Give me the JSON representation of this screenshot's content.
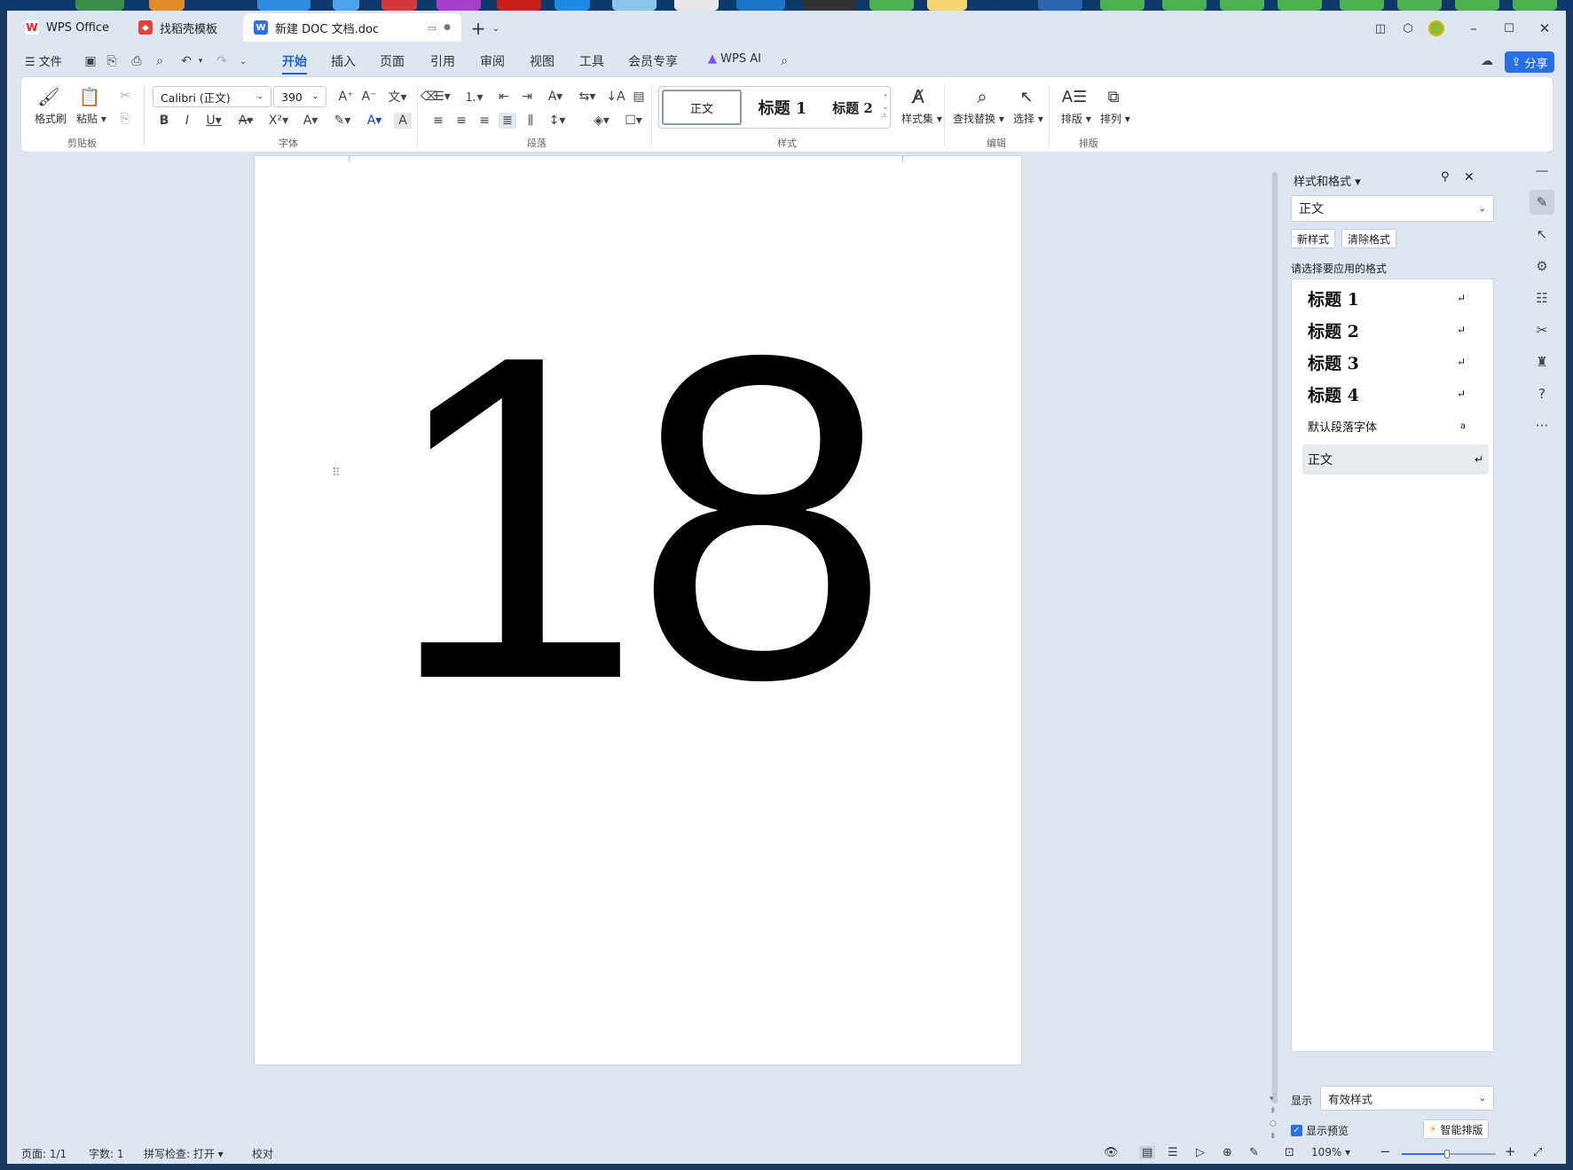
{
  "tabs": [
    {
      "label": "WPS Office",
      "icon": "wps-logo-icon"
    },
    {
      "label": "找稻壳模板",
      "icon": "docer-icon"
    },
    {
      "label": "新建 DOC 文档.doc",
      "icon": "word-doc-icon"
    }
  ],
  "menu": {
    "file": "文件",
    "tabs": [
      "开始",
      "插入",
      "页面",
      "引用",
      "审阅",
      "视图",
      "工具",
      "会员专享"
    ],
    "active": "开始",
    "wps_ai": "WPS AI",
    "share": "分享"
  },
  "ribbon": {
    "clipboard": {
      "format_painter": "格式刷",
      "paste": "粘贴",
      "group": "剪贴板"
    },
    "font": {
      "name": "Calibri (正文)",
      "size": "390",
      "group": "字体"
    },
    "paragraph": {
      "group": "段落"
    },
    "styles": {
      "items": [
        "正文",
        "标题 1",
        "标题 2"
      ],
      "style_set": "样式集",
      "group": "样式"
    },
    "edit": {
      "find_replace": "查找替换",
      "select": "选择",
      "group": "编辑"
    },
    "layout": {
      "typeset": "排版",
      "arrange": "排列",
      "group": "排版"
    }
  },
  "document": {
    "content": "18"
  },
  "panel": {
    "title": "样式和格式",
    "current_style": "正文",
    "new_style": "新样式",
    "clear_format": "清除格式",
    "prompt": "请选择要应用的格式",
    "styles": [
      {
        "label": "标题 1",
        "mark": "↵"
      },
      {
        "label": "标题 2",
        "mark": "↵"
      },
      {
        "label": "标题 3",
        "mark": "↵"
      },
      {
        "label": "标题 4",
        "mark": "↵"
      },
      {
        "label": "默认段落字体",
        "mark": "a"
      },
      {
        "label": "正文",
        "mark": "↵"
      }
    ],
    "show_label": "显示",
    "show_value": "有效样式",
    "preview_label": "显示预览",
    "smart_layout": "智能排版"
  },
  "status": {
    "page": "页面: 1/1",
    "words": "字数: 1",
    "spell": "拼写检查: 打开",
    "proof": "校对",
    "zoom": "109%"
  }
}
